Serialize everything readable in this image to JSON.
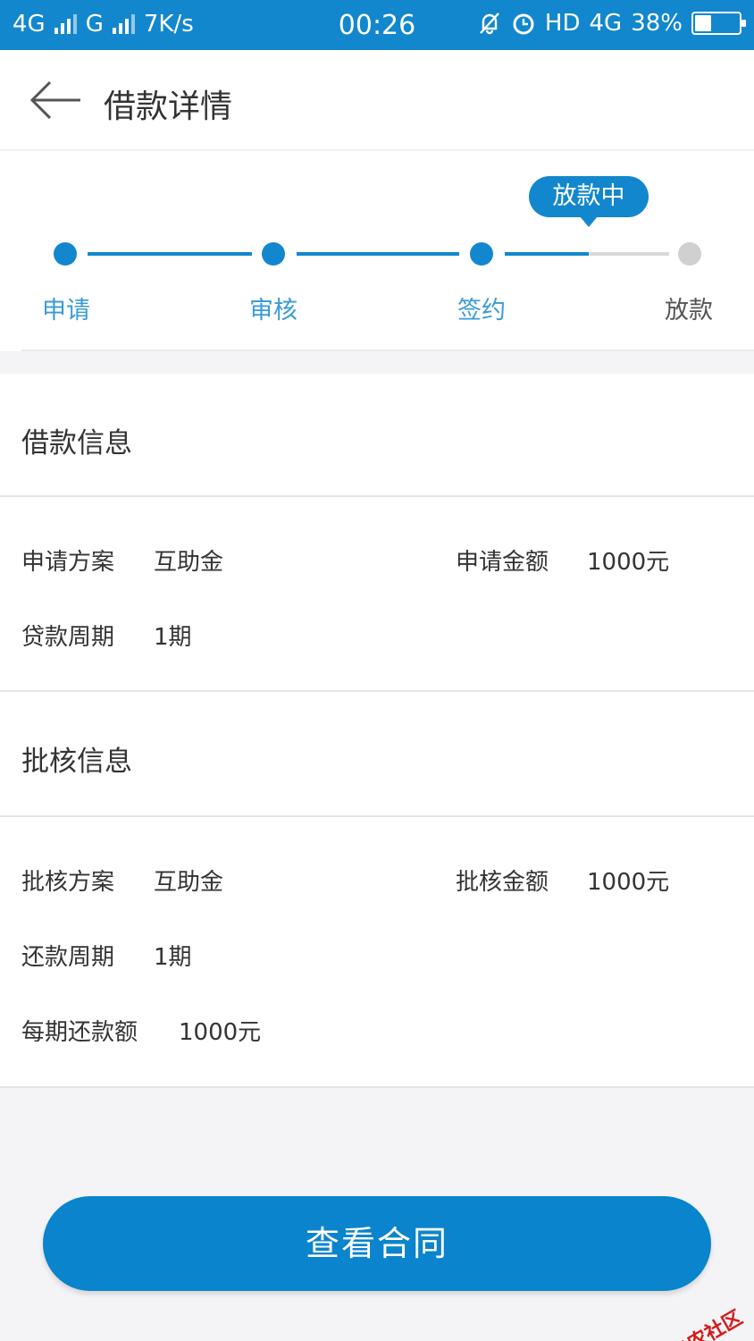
{
  "status_bar": {
    "network1": "4G",
    "network2": "G",
    "speed": "7K/s",
    "time": "00:26",
    "hd": "HD",
    "network3": "4G",
    "battery": "38%",
    "battery_level": 0.38
  },
  "header": {
    "title": "借款详情",
    "back_icon": "arrow-left-icon"
  },
  "progress": {
    "bubble": "放款中",
    "steps": [
      {
        "label": "申请",
        "done": true
      },
      {
        "label": "审核",
        "done": true
      },
      {
        "label": "签约",
        "done": true
      },
      {
        "label": "放款",
        "done": false
      }
    ],
    "accent": "#1287cd",
    "pending": "#d0d0d0"
  },
  "loan_info": {
    "title": "借款信息",
    "plan_label": "申请方案",
    "plan_value": "互助金",
    "amount_label": "申请金额",
    "amount_value": "1000元",
    "period_label": "贷款周期",
    "period_value": "1期"
  },
  "approval_info": {
    "title": "批核信息",
    "plan_label": "批核方案",
    "plan_value": "互助金",
    "amount_label": "批核金额",
    "amount_value": "1000元",
    "period_label": "还款周期",
    "period_value": "1期",
    "installment_label": "每期还款额",
    "installment_value": "1000元"
  },
  "actions": {
    "view_contract": "查看合同"
  },
  "watermark": "卡农社区"
}
